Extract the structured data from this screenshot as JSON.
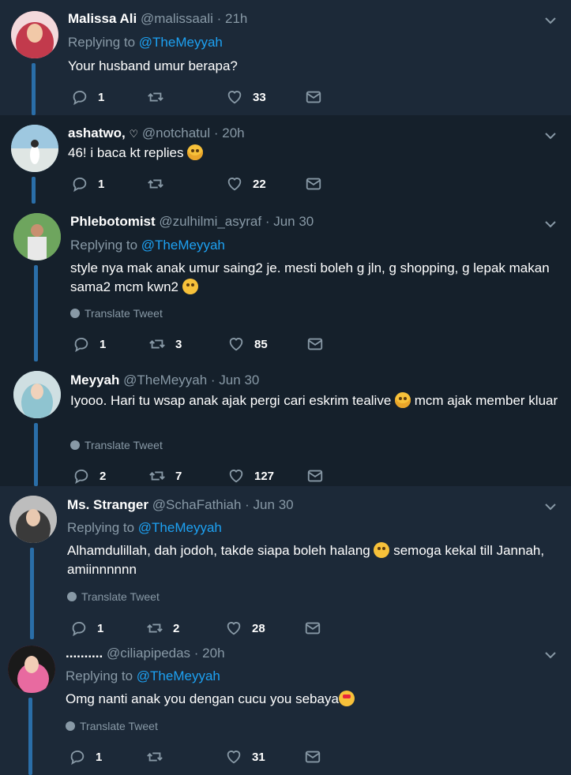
{
  "tweets": [
    {
      "name": "Malissa Ali",
      "handle": "@malissaali",
      "time": "· 21h",
      "replying_prefix": "Replying to ",
      "replying_to": "@TheMeyyah",
      "text": "Your husband umur berapa?",
      "replies": "1",
      "retweets": "",
      "likes": "33",
      "avatar_color": "#b83a48"
    },
    {
      "name": "ashatwo,",
      "name_suffix": "♡",
      "handle": "@notchatul",
      "time": "· 20h",
      "text": "46! i baca kt replies",
      "replies": "1",
      "retweets": "",
      "likes": "22",
      "avatar_color": "#7fb3cc"
    },
    {
      "name": "Phlebotomist",
      "handle": "@zulhilmi_asyraf",
      "time": "· Jun 30",
      "replying_prefix": "Replying to ",
      "replying_to": "@TheMeyyah",
      "text": "style nya mak anak umur saing2 je. mesti boleh g jln, g shopping, g lepak makan sama2 mcm kwn2",
      "translate": "Translate Tweet",
      "replies": "1",
      "retweets": "3",
      "likes": "85",
      "avatar_color": "#5f8f5a"
    },
    {
      "name": "Meyyah",
      "handle": "@TheMeyyah",
      "time": "· Jun 30",
      "text_part1": "Iyooo. Hari tu wsap anak ajak pergi cari eskrim tealive",
      "text_part2": "mcm ajak member kluar",
      "translate": "Translate Tweet",
      "replies": "2",
      "retweets": "7",
      "likes": "127",
      "avatar_color": "#a9c7cf"
    },
    {
      "name": "Ms. Stranger",
      "handle": "@SchaFathiah",
      "time": "· Jun 30",
      "replying_prefix": "Replying to ",
      "replying_to": "@TheMeyyah",
      "text_part1": "Alhamdulillah, dah jodoh, takde siapa boleh halang",
      "text_part2": "semoga kekal till Jannah, amiinnnnnn",
      "translate": "Translate Tweet",
      "replies": "1",
      "retweets": "2",
      "likes": "28",
      "avatar_color": "#8a8a8a"
    },
    {
      "name": "..........",
      "handle": "@ciliapipedas",
      "time": "· 20h",
      "replying_prefix": "Replying to ",
      "replying_to": "@TheMeyyah",
      "text": "Omg nanti anak you dengan cucu you sebaya",
      "translate": "Translate Tweet",
      "replies": "1",
      "retweets": "",
      "likes": "31",
      "avatar_color": "#c4467a"
    }
  ]
}
